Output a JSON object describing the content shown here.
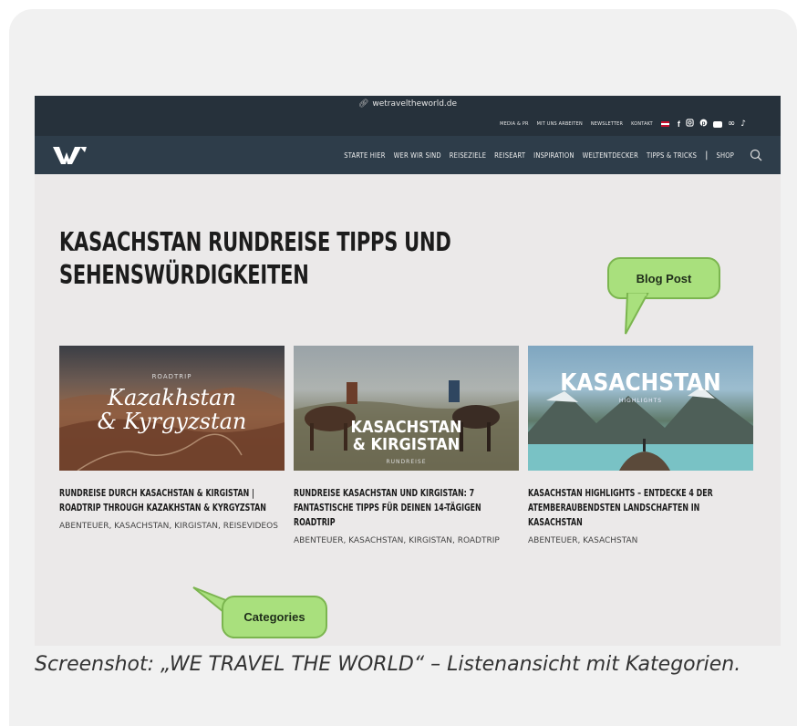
{
  "browser": {
    "url": "wetraveltheworld.de"
  },
  "top_menu": [
    "MEDIA & PR",
    "MIT UNS ARBEITEN",
    "NEWSLETTER",
    "KONTAKT"
  ],
  "main_nav": [
    "STARTE HIER",
    "WER WIR SIND",
    "REISEZIELE",
    "REISEART",
    "INSPIRATION",
    "WELTENTDECKER",
    "TIPPS & TRICKS",
    "SHOP"
  ],
  "page": {
    "title_line1": "KASACHSTAN RUNDREISE TIPPS UND",
    "title_line2": "SEHENSWÜRDIGKEITEN"
  },
  "posts": [
    {
      "thumb_small": "ROADTRIP",
      "thumb_line1": "Kazakhstan",
      "thumb_line2": "& Kyrgyzstan",
      "title": "RUNDREISE DURCH KASACHSTAN & KIRGISTAN | ROADTRIP THROUGH KAZAKHSTAN & KYRGYZSTAN",
      "categories": "ABENTEUER, KASACHSTAN, KIRGISTAN, REISEVIDEOS"
    },
    {
      "thumb_line1": "KASACHSTAN",
      "thumb_line2": "& KIRGISTAN",
      "thumb_small": "RUNDREISE",
      "title": "RUNDREISE KASACHSTAN UND KIRGISTAN: 7 FANTASTISCHE TIPPS FÜR DEINEN 14-TÄGIGEN ROADTRIP",
      "categories": "ABENTEUER, KASACHSTAN, KIRGISTAN, ROADTRIP"
    },
    {
      "thumb_line1": "KASACHSTAN",
      "thumb_small": "HIGHLIGHTS",
      "title": "KASACHSTAN HIGHLIGHTS – ENTDECKE 4 DER ATEMBERAUBENDSTEN LANDSCHAFTEN IN KASACHSTAN",
      "categories": "ABENTEUER, KASACHSTAN"
    }
  ],
  "annotations": {
    "blog_post": "Blog Post",
    "categories": "Categories"
  },
  "caption": "Screenshot: „WE TRAVEL THE WORLD“ – Listenansicht mit Kategorien.",
  "colors": {
    "nav_dark": "#26313b",
    "nav_main": "#2e3d4a",
    "bubble_fill": "#a9e07d",
    "bubble_border": "#7bb54f"
  }
}
